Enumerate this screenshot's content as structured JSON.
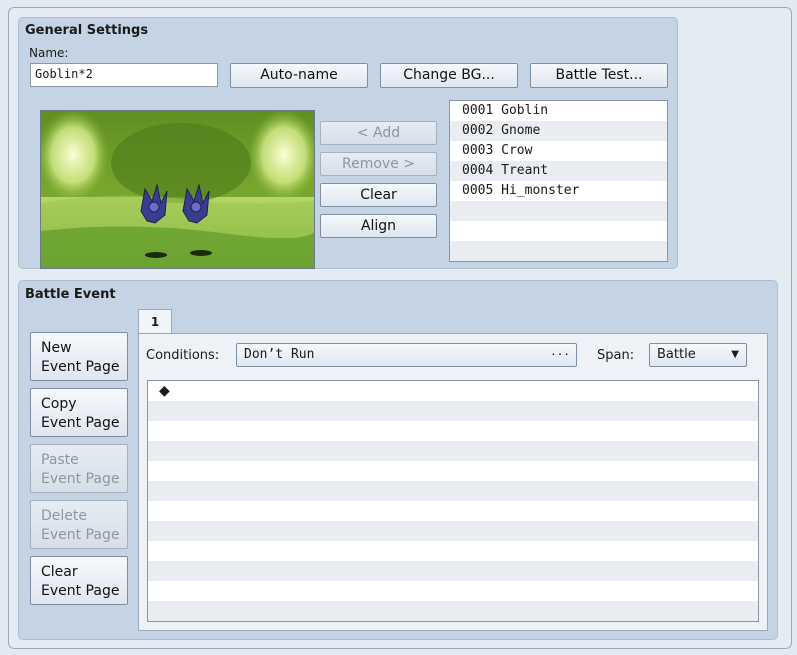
{
  "general": {
    "title": "General Settings",
    "name_label": "Name:",
    "name_value": "Goblin*2",
    "auto_name": "Auto-name",
    "change_bg": "Change BG...",
    "battle_test": "Battle Test...",
    "add": "< Add",
    "remove": "Remove >",
    "clear": "Clear",
    "align": "Align",
    "enemies": [
      "0001 Goblin",
      "0002 Gnome",
      "0003 Crow",
      "0004 Treant",
      "0005 Hi_monster"
    ]
  },
  "battle_event": {
    "title": "Battle Event",
    "buttons": {
      "new_line1": "New",
      "new_line2": "Event Page",
      "copy_line1": "Copy",
      "copy_line2": "Event Page",
      "paste_line1": "Paste",
      "paste_line2": "Event Page",
      "delete_line1": "Delete",
      "delete_line2": "Event Page",
      "clear_line1": "Clear",
      "clear_line2": "Event Page"
    },
    "tab_label": "1",
    "conditions_label": "Conditions:",
    "conditions_value": "Don’t Run",
    "ellipsis": "···",
    "span_label": "Span:",
    "span_value": "Battle",
    "event_marker": "◆"
  }
}
